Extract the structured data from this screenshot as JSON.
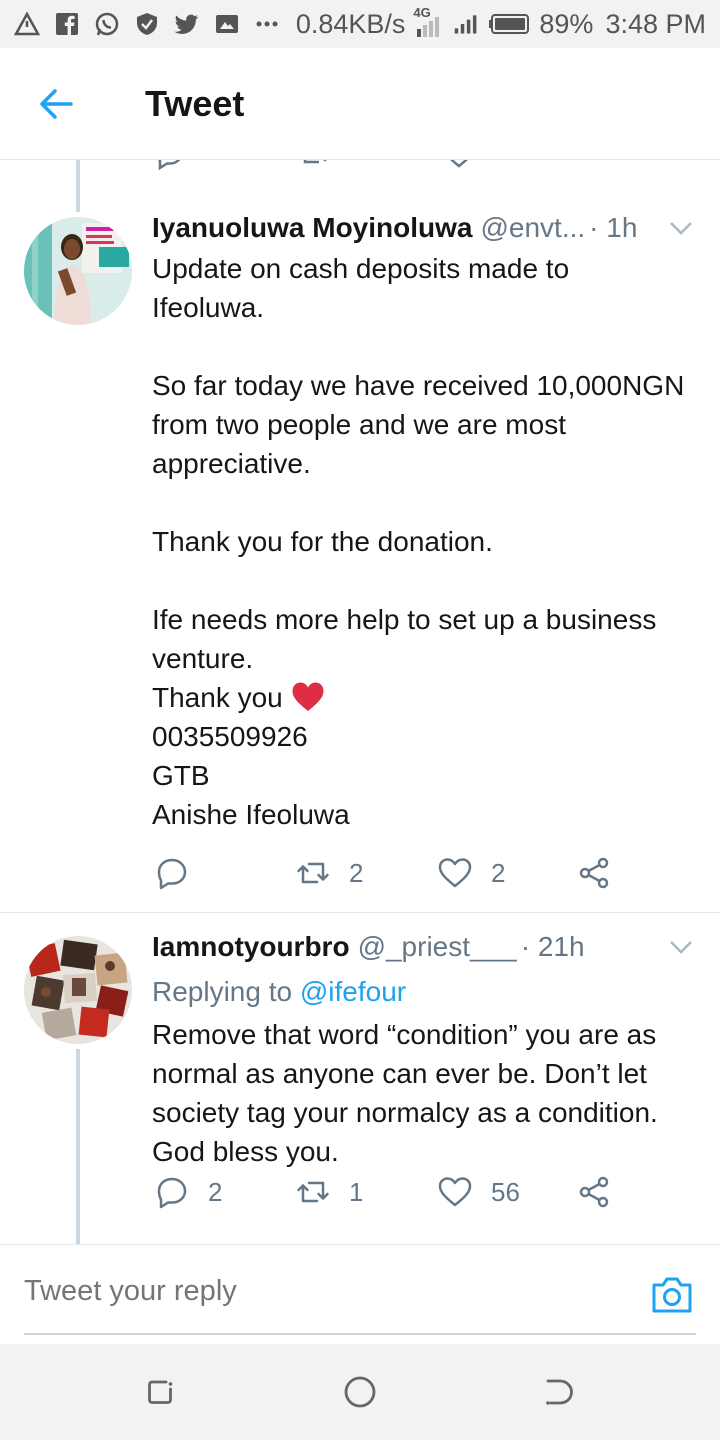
{
  "status_bar": {
    "speed": "0.84KB/s",
    "network": "4G",
    "battery": "89%",
    "time": "3:48 PM"
  },
  "header": {
    "title": "Tweet"
  },
  "tweets": [
    {
      "name": "Iyanuoluwa Moyinoluwa",
      "handle": "@envt...",
      "time": "· 1h",
      "lines": [
        "Update on cash deposits made to Ifeoluwa.",
        "So far today we have received 10,000NGN from two people and we are most appreciative.",
        "Thank you for the donation.",
        "Ife needs more help to set up a business venture.",
        "Thank you",
        "0035509926",
        "GTB",
        "Anishe Ifeoluwa"
      ],
      "replies": "",
      "retweets": "2",
      "likes": "2"
    },
    {
      "name": "Iamnotyourbro",
      "handle": "@_priest___",
      "time": "· 21h",
      "replying_prefix": "Replying to",
      "replying_to": "@ifefour",
      "text": "Remove that word “condition” you are as normal as anyone can ever be. Don’t let society tag your normalcy as a condition. God bless you.",
      "replies": "2",
      "retweets": "1",
      "likes": "56"
    }
  ],
  "composer": {
    "placeholder": "Tweet your reply"
  },
  "colors": {
    "accent": "#1da1f2",
    "muted": "#657786",
    "text": "#14171a",
    "heart": "#e0245e"
  }
}
